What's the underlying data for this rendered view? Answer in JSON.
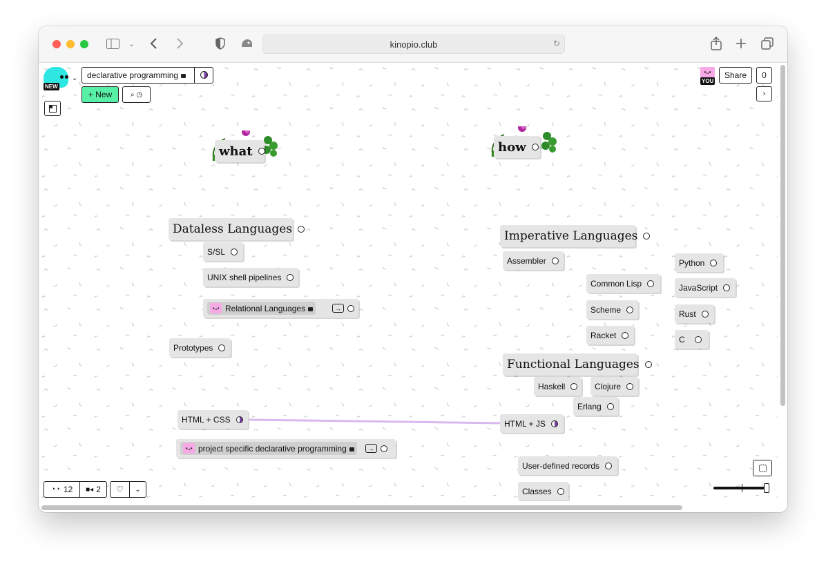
{
  "browser": {
    "url": "kinopio.club"
  },
  "header": {
    "new_badge": "NEW",
    "space_name": "declarative programming",
    "new_button": "+ New",
    "you_badge": "YOU",
    "share_button": "Share",
    "notification_count": "0"
  },
  "footer": {
    "readers_count": "12",
    "collaborators_count": "2"
  },
  "canvas": {
    "headings": {
      "what": "what",
      "how": "how"
    },
    "cards": {
      "dataless": "Dataless Languages",
      "ssl": "S/SL",
      "unix": "UNIX shell pipelines",
      "relational": "Relational Languages",
      "prototypes": "Prototypes",
      "html_css": "HTML + CSS",
      "project_specific": "project specific declarative programming",
      "imperative": "Imperative Languages",
      "assembler": "Assembler",
      "common_lisp": "Common Lisp",
      "scheme": "Scheme",
      "racket": "Racket",
      "python": "Python",
      "javascript": "JavaScript",
      "rust": "Rust",
      "c": "C",
      "functional": "Functional Languages",
      "haskell": "Haskell",
      "clojure": "Clojure",
      "erlang": "Erlang",
      "html_js": "HTML + JS",
      "user_defined": "User-defined records",
      "classes": "Classes"
    },
    "connection_color": "#d9b8ee"
  },
  "colors": {
    "new_button": "#58f0a6",
    "avatar": "#2ee6e2",
    "face_badge": "#f7a9e6",
    "card": "#e5e5e5"
  }
}
